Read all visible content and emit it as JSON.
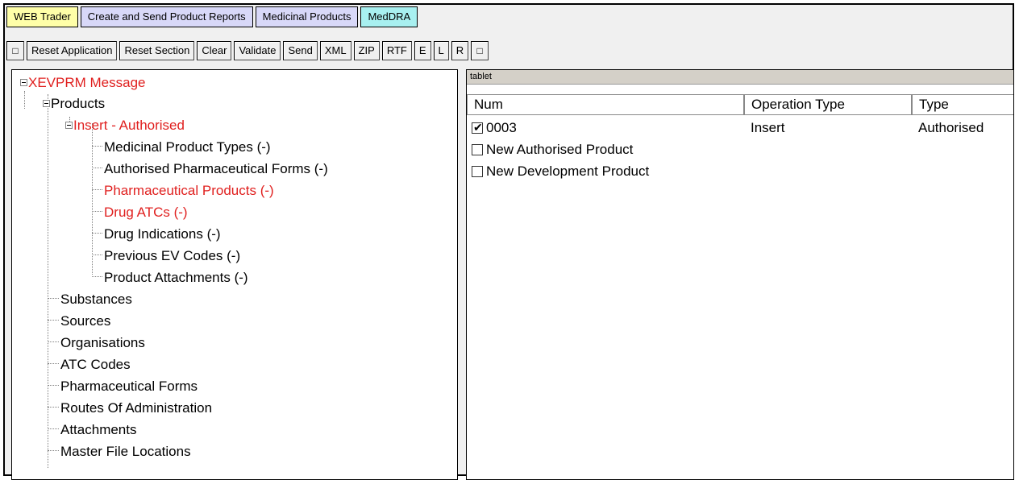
{
  "tabs": [
    {
      "label": "WEB Trader",
      "color": "#ffffa8"
    },
    {
      "label": "Create and Send Product Reports",
      "color": "#d8d8f8"
    },
    {
      "label": "Medicinal Products",
      "color": "#d8d8f8"
    },
    {
      "label": "MedDRA",
      "color": "#a8f0f0"
    }
  ],
  "toolbar": {
    "square1": "□",
    "reset_application": "Reset Application",
    "reset_section": "Reset Section",
    "clear": "Clear",
    "validate": "Validate",
    "send": "Send",
    "xml": "XML",
    "zip": "ZIP",
    "rtf": "RTF",
    "e": "E",
    "l": "L",
    "r": "R",
    "square2": "□"
  },
  "tree": {
    "root": "XEVPRM Message",
    "products": "Products",
    "insert": "Insert - Authorised",
    "children": [
      {
        "label": "Medicinal Product Types (-)",
        "red": false
      },
      {
        "label": "Authorised Pharmaceutical Forms (-)",
        "red": false
      },
      {
        "label": "Pharmaceutical Products (-)",
        "red": true
      },
      {
        "label": "Drug ATCs (-)",
        "red": true
      },
      {
        "label": "Drug Indications (-)",
        "red": false
      },
      {
        "label": "Previous EV Codes (-)",
        "red": false
      },
      {
        "label": "Product Attachments (-)",
        "red": false
      }
    ],
    "sections": [
      "Substances",
      "Sources",
      "Organisations",
      "ATC Codes",
      "Pharmaceutical Forms",
      "Routes Of Administration",
      "Attachments",
      "Master File Locations"
    ]
  },
  "right": {
    "bar_label": "tablet",
    "columns": [
      "Num",
      "Operation Type",
      "Type"
    ],
    "rows": [
      {
        "num": "0003",
        "op": "Insert",
        "type": "Authorised",
        "checked": true
      },
      {
        "num": "New Authorised Product",
        "op": "",
        "type": "",
        "checked": false
      },
      {
        "num": "New Development Product",
        "op": "",
        "type": "",
        "checked": false
      }
    ]
  }
}
